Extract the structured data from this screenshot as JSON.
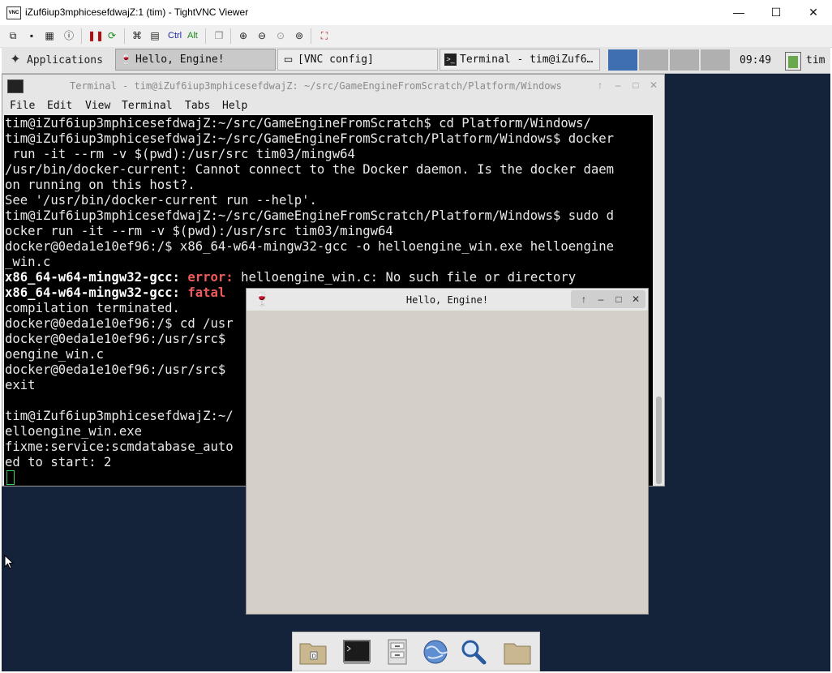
{
  "vnc": {
    "title": "iZuf6iup3mphicesefdwajZ:1 (tim) - TightVNC Viewer",
    "logo_text": "VNC",
    "minimize": "—",
    "maximize": "☐",
    "close": "✕",
    "toolbar": {
      "ctrl_label": "Ctrl",
      "alt_label": "Alt"
    }
  },
  "panel": {
    "applications_label": "Applications",
    "tasks": [
      {
        "label": "Hello, Engine!",
        "icon": "wine-icon"
      },
      {
        "label": "[VNC config]",
        "icon": "window-icon"
      },
      {
        "label": "Terminal - tim@iZuf6…",
        "icon": "terminal-icon"
      }
    ],
    "clock": "09:49",
    "user": "tim"
  },
  "terminal": {
    "title": "Terminal - tim@iZuf6iup3mphicesefdwajZ: ~/src/GameEngineFromScratch/Platform/Windows",
    "menu": [
      "File",
      "Edit",
      "View",
      "Terminal",
      "Tabs",
      "Help"
    ],
    "lines": [
      "tim@iZuf6iup3mphicesefdwajZ:~/src/GameEngineFromScratch$ cd Platform/Windows/",
      "tim@iZuf6iup3mphicesefdwajZ:~/src/GameEngineFromScratch/Platform/Windows$ docker",
      " run -it --rm -v $(pwd):/usr/src tim03/mingw64",
      "/usr/bin/docker-current: Cannot connect to the Docker daemon. Is the docker daem",
      "on running on this host?.",
      "See '/usr/bin/docker-current run --help'.",
      "tim@iZuf6iup3mphicesefdwajZ:~/src/GameEngineFromScratch/Platform/Windows$ sudo d",
      "ocker run -it --rm -v $(pwd):/usr/src tim03/mingw64",
      "docker@0eda1e10ef96:/$ x86_64-w64-mingw32-gcc -o helloengine_win.exe helloengine",
      "_win.c"
    ],
    "err1_prog": "x86_64-w64-mingw32-gcc:",
    "err1_kind": "error:",
    "err1_msg": "helloengine_win.c: No such file or directory",
    "err2_prog": "x86_64-w64-mingw32-gcc:",
    "err2_kind": "fatal",
    "lines2": [
      "compilation terminated.",
      "docker@0eda1e10ef96:/$ cd /usr",
      "docker@0eda1e10ef96:/usr/src$",
      "oengine_win.c",
      "docker@0eda1e10ef96:/usr/src$",
      "exit",
      "",
      "tim@iZuf6iup3mphicesefdwajZ:~/",
      "elloengine_win.exe",
      "fixme:service:scmdatabase_auto",
      "ed to start: 2"
    ]
  },
  "hello_window": {
    "title": "Hello, Engine!"
  },
  "dock": {
    "items": [
      "home-folder-icon",
      "terminal-icon",
      "file-cabinet-icon",
      "web-browser-icon",
      "search-icon",
      "folder-icon"
    ]
  }
}
